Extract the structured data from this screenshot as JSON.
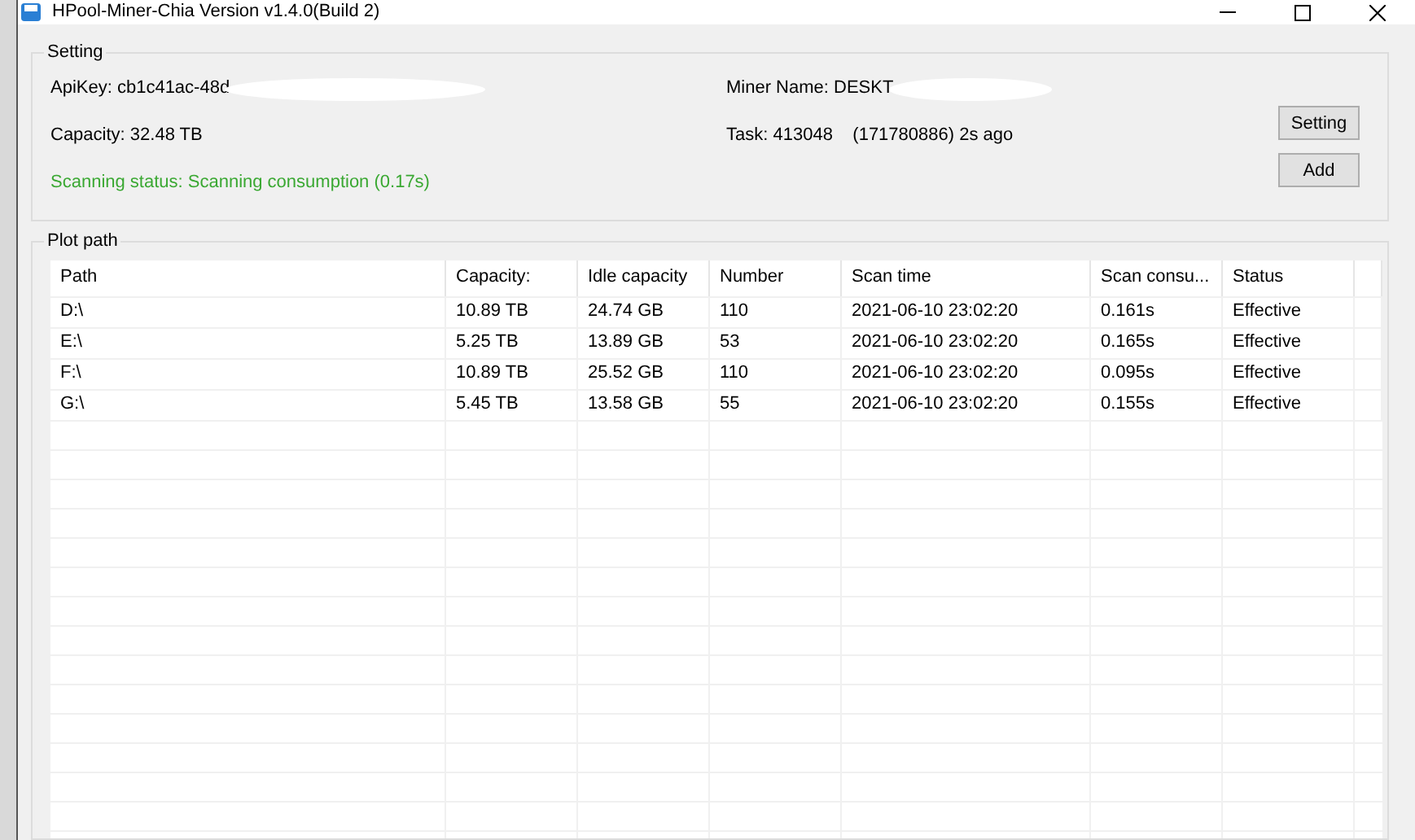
{
  "window": {
    "title": "HPool-Miner-Chia  Version v1.4.0(Build 2)"
  },
  "setting": {
    "title": "Setting",
    "api_key": "ApiKey: cb1c41ac-48d",
    "miner_name": "Miner Name: DESKT",
    "capacity": "Capacity: 32.48 TB",
    "task": "Task: 413048    (171780886) 2s ago",
    "scanning_status": "Scanning status: Scanning consumption (0.17s)",
    "buttons": [
      "Setting",
      "Add"
    ]
  },
  "plot_path": {
    "title": "Plot path",
    "columns": [
      "Path",
      "Capacity:",
      "Idle capacity",
      "Number",
      "Scan time",
      "Scan consu...",
      "Status"
    ],
    "rows": [
      [
        "D:\\",
        "10.89 TB",
        "24.74 GB",
        "110",
        "2021-06-10 23:02:20",
        "0.161s",
        "Effective"
      ],
      [
        "E:\\",
        "5.25 TB",
        "13.89 GB",
        "53",
        "2021-06-10 23:02:20",
        "0.165s",
        "Effective"
      ],
      [
        "F:\\",
        "10.89 TB",
        "25.52 GB",
        "110",
        "2021-06-10 23:02:20",
        "0.095s",
        "Effective"
      ],
      [
        "G:\\",
        "5.45 TB",
        "13.58 GB",
        "55",
        "2021-06-10 23:02:20",
        "0.155s",
        "Effective"
      ]
    ]
  }
}
